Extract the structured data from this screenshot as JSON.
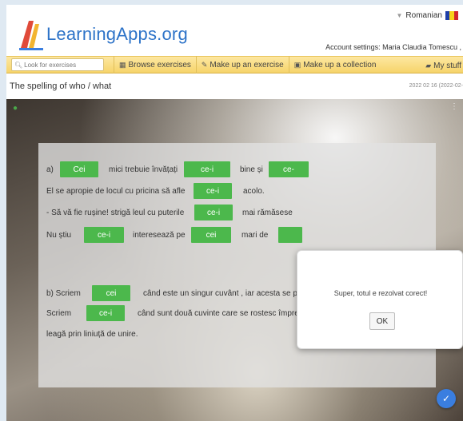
{
  "header": {
    "logo_text": "LearningApps.org",
    "language": "Romanian",
    "account": "Account settings: Maria Claudia Tomescu ,"
  },
  "toolbar": {
    "search_placeholder": "Look for exercises",
    "browse": "Browse exercises",
    "make_exercise": "Make up an exercise",
    "make_collection": "Make up a collection",
    "my_stuff": "My stuff"
  },
  "page": {
    "title": "The spelling of who / what",
    "date": "2022 02 16 (2022-02-"
  },
  "exercise": {
    "a_label": "a)",
    "line1_text1": "mici trebuie învățați",
    "line1_text2": "bine și",
    "line2_text1": "El se apropie de locul cu pricina să afle",
    "line2_text2": "acolo.",
    "line3_text1": "- Să vă fie rușine! strigă leul cu puterile",
    "line3_text2": "mai rămăsese",
    "line4_text1": "Nu știu",
    "line4_text2": "interesează pe",
    "line4_text3": "mari de",
    "b_line1_start": "b) Scriem",
    "b_line1_rest": "când este un singur cuvânt , iar acesta se poate înlocui cu „acei\".",
    "b_line2_start": "Scriem",
    "b_line2_rest": "când sunt două cuvinte care se rostesc împreună într-o singură silabă, în scris se",
    "b_line3": "leagă prin liniuță de unire.",
    "chips": {
      "c1": "Cei",
      "c2": "ce-i",
      "c3": "ce-",
      "c4": "ce-i",
      "c5": "ce-i",
      "c6": "ce-i",
      "c7": "cei",
      "c8": "cei",
      "c9": "ce-i"
    }
  },
  "dialog": {
    "message": "Super, totul e rezolvat corect!",
    "ok": "OK"
  },
  "colors": {
    "accent_blue": "#2d73c8",
    "chip_green": "#4cb84c",
    "toolbar_yellow": "#f6d46a"
  },
  "icons": {
    "check_fab": "check-badge-icon",
    "browse": "grid-icon",
    "make": "pencil-icon",
    "collection": "collection-icon",
    "mystuff": "folder-icon"
  }
}
